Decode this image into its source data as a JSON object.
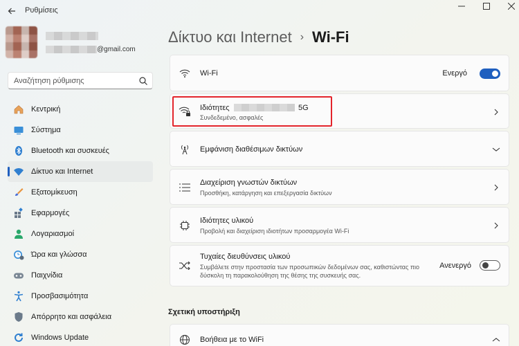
{
  "window": {
    "title": "Ρυθμίσεις"
  },
  "user": {
    "email_suffix": "@gmail.com"
  },
  "search": {
    "placeholder": "Αναζήτηση ρύθμισης"
  },
  "nav": {
    "items": [
      {
        "label": "Κεντρική",
        "icon": "home-icon"
      },
      {
        "label": "Σύστημα",
        "icon": "system-icon"
      },
      {
        "label": "Bluetooth και συσκευές",
        "icon": "bluetooth-icon"
      },
      {
        "label": "Δίκτυο και Internet",
        "icon": "network-icon",
        "active": true
      },
      {
        "label": "Εξατομίκευση",
        "icon": "brush-icon"
      },
      {
        "label": "Εφαρμογές",
        "icon": "apps-icon"
      },
      {
        "label": "Λογαριασμοί",
        "icon": "account-icon"
      },
      {
        "label": "Ώρα και γλώσσα",
        "icon": "clock-globe-icon"
      },
      {
        "label": "Παιχνίδια",
        "icon": "gamepad-icon"
      },
      {
        "label": "Προσβασιμότητα",
        "icon": "accessibility-icon"
      },
      {
        "label": "Απόρρητο και ασφάλεια",
        "icon": "shield-icon"
      },
      {
        "label": "Windows Update",
        "icon": "update-icon"
      }
    ]
  },
  "header": {
    "parent": "Δίκτυο και Internet",
    "separator": "›",
    "current": "Wi-Fi"
  },
  "cards": {
    "wifi": {
      "title": "Wi-Fi",
      "toggle_label": "Ενεργό",
      "toggle_on": true
    },
    "properties": {
      "title_prefix": "Ιδιότητες",
      "title_suffix": "5G",
      "subtitle": "Συνδεδεμένο, ασφαλές"
    },
    "available": {
      "title": "Εμφάνιση διαθέσιμων δικτύων"
    },
    "known": {
      "title": "Διαχείριση γνωστών δικτύων",
      "subtitle": "Προσθήκη, κατάργηση και επεξεργασία δικτύων"
    },
    "hardware": {
      "title": "Ιδιότητες υλικού",
      "subtitle": "Προβολή και διαχείριση ιδιοτήτων προσαρμογέα Wi-Fi"
    },
    "random": {
      "title": "Τυχαίες διευθύνσεις υλικού",
      "subtitle_line1": "Συμβάλετε στην προστασία των προσωπικών δεδομένων σας, καθιστώντας πιο",
      "subtitle_line2": "δύσκολη τη παρακολούθηση της θέσης της συσκευής σας.",
      "toggle_label": "Ανενεργό",
      "toggle_on": false
    },
    "help": {
      "title": "Βοήθεια με το WiFi"
    }
  },
  "support": {
    "title": "Σχετική υποστήριξη"
  },
  "colors": {
    "accent": "#1f5fbf",
    "highlight": "#e3242b"
  }
}
